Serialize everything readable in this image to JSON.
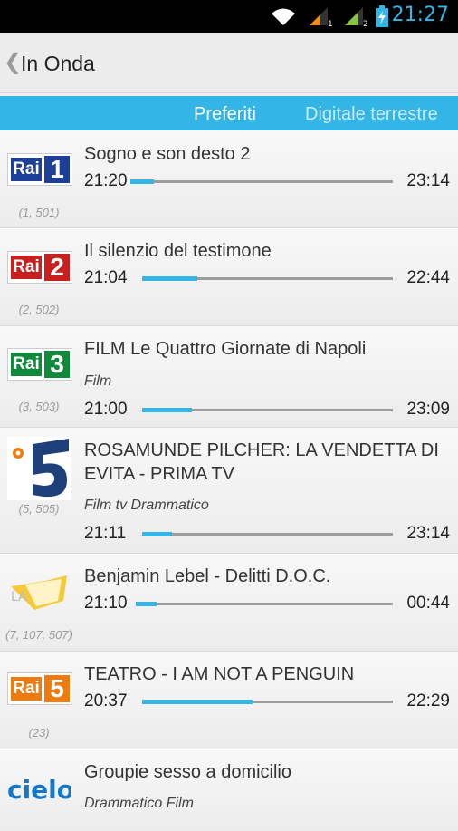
{
  "status_bar": {
    "time": "21:27",
    "icons": [
      "wifi-icon",
      "signal-sim1-icon",
      "signal-sim2-icon",
      "battery-charging-icon"
    ]
  },
  "action_bar": {
    "back_icon": "chevron-left-icon",
    "title": "In Onda"
  },
  "tabs": [
    {
      "label": "Preferiti",
      "active": true
    },
    {
      "label": "Digitale terrestre",
      "active": false
    }
  ],
  "colors": {
    "accent": "#33b5e5",
    "rai1": "#1d3f97",
    "rai2": "#c8201f",
    "rai3": "#0e8a3a",
    "rai5": "#ee7b0d",
    "cielo": "#1478c8"
  },
  "programs": [
    {
      "channel_logo": "rai-1-logo",
      "channels": "(1, 501)",
      "title": "Sogno e son desto 2",
      "genre": "",
      "start": "21:20",
      "end": "23:14",
      "progress": 0.09
    },
    {
      "channel_logo": "rai-2-logo",
      "channels": "(2, 502)",
      "title": "Il silenzio del testimone",
      "genre": "",
      "start": "21:04",
      "end": "22:44",
      "progress": 0.22
    },
    {
      "channel_logo": "rai-3-logo",
      "channels": "(3, 503)",
      "title": "FILM Le Quattro Giornate di Napoli",
      "genre": "Film",
      "start": "21:00",
      "end": "23:09",
      "progress": 0.2
    },
    {
      "channel_logo": "canale-5-logo",
      "channels": "(5, 505)",
      "title": "ROSAMUNDE PILCHER: LA VENDETTA DI EVITA - PRIMA TV",
      "genre": "Film tv Drammatico",
      "start": "21:11",
      "end": "23:14",
      "progress": 0.12
    },
    {
      "channel_logo": "la7-logo",
      "channels": "(7, 107, 507)",
      "title": "Benjamin Lebel - Delitti D.O.C.",
      "genre": "",
      "start": "21:10",
      "end": "00:44",
      "progress": 0.08
    },
    {
      "channel_logo": "rai-5-logo",
      "channels": "(23)",
      "title": "TEATRO - I AM NOT A PENGUIN",
      "genre": "",
      "start": "20:37",
      "end": "22:29",
      "progress": 0.44
    },
    {
      "channel_logo": "cielo-logo",
      "channels": "",
      "title": "Groupie sesso a domicilio",
      "genre": "Drammatico Film",
      "start": "",
      "end": "",
      "progress": null
    }
  ]
}
